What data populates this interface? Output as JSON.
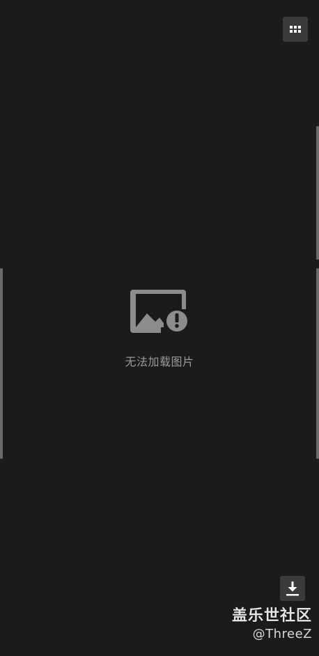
{
  "toolbar": {
    "grid_icon": "grid-icon",
    "download_icon": "download-icon"
  },
  "viewer": {
    "error_icon": "broken-image-icon",
    "error_message": "无法加载图片"
  },
  "watermark": {
    "site": "盖乐世社区",
    "user": "@ThreeZ"
  },
  "colors": {
    "background": "#1b1b1b",
    "button_bg": "#3a3a3a",
    "icon_gray": "#8c8c8c",
    "text_gray": "#9a9a9a"
  }
}
